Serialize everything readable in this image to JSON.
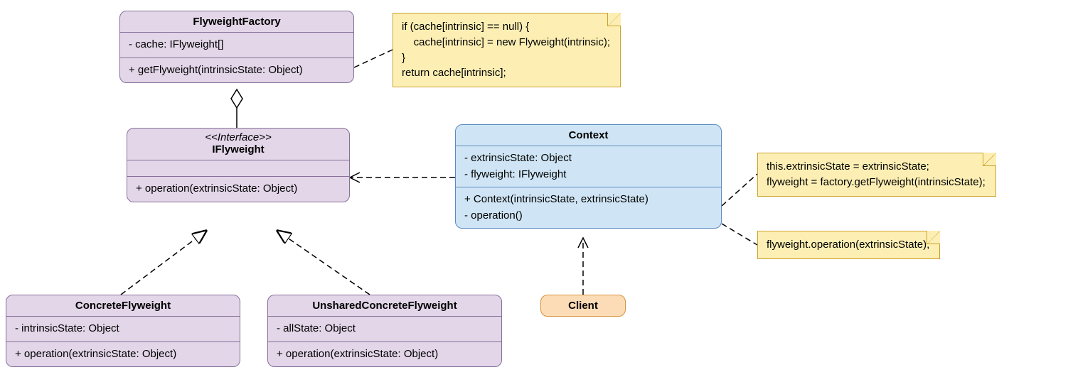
{
  "classes": {
    "factory": {
      "name": "FlyweightFactory",
      "attrs": "- cache: IFlyweight[]",
      "methods": "+ getFlyweight(intrinsicState: Object)"
    },
    "iflyweight": {
      "stereotype": "<<Interface>>",
      "name": "IFlyweight",
      "methods": "+ operation(extrinsicState: Object)"
    },
    "context": {
      "name": "Context",
      "attrs": "- extrinsicState: Object\n- flyweight: IFlyweight",
      "methods": "+ Context(intrinsicState, extrinsicState)\n- operation()"
    },
    "concrete": {
      "name": "ConcreteFlyweight",
      "attrs": "- intrinsicState: Object",
      "methods": "+ operation(extrinsicState: Object)"
    },
    "unshared": {
      "name": "UnsharedConcreteFlyweight",
      "attrs": "- allState: Object",
      "methods": "+ operation(extrinsicState: Object)"
    },
    "client": {
      "name": "Client"
    }
  },
  "notes": {
    "factoryNote": "if (cache[intrinsic] == null) {\n    cache[intrinsic] = new Flyweight(intrinsic);\n}\nreturn cache[intrinsic];",
    "ctxNote1": "this.extrinsicState = extrinsicState;\nflyweight = factory.getFlyweight(intrinsicState);",
    "ctxNote2": "flyweight.operation(extrinsicState);"
  }
}
